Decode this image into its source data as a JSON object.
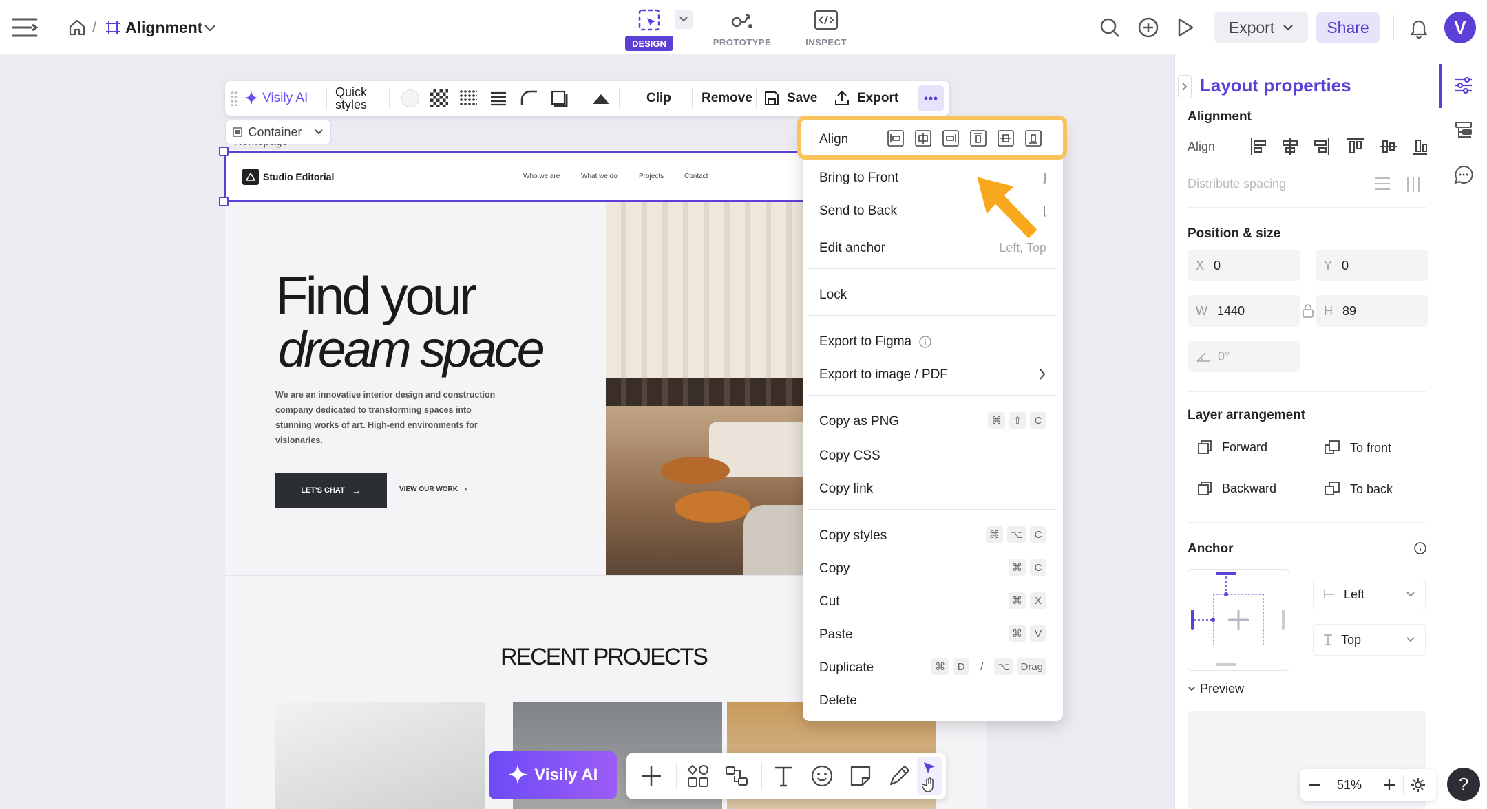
{
  "header": {
    "breadcrumb_sep": "/",
    "file_name": "Alignment",
    "modes": [
      {
        "label": "DESIGN",
        "active": true
      },
      {
        "label": "PROTOTYPE",
        "active": false
      },
      {
        "label": "INSPECT",
        "active": false
      }
    ],
    "export_label": "Export",
    "share_label": "Share",
    "avatar_letter": "V"
  },
  "toolbar": {
    "visily_ai": "Visily AI",
    "quick_styles_line1": "Quick",
    "quick_styles_line2": "styles",
    "clip": "Clip",
    "remove": "Remove",
    "save": "Save",
    "export": "Export"
  },
  "selection": {
    "container_label": "Container",
    "layer_label": "Homepage"
  },
  "page": {
    "nav_brand": "Studio Editorial",
    "nav_links": [
      "Who we are",
      "What we do",
      "Projects",
      "Contact"
    ],
    "hero_title_1": "Find your",
    "hero_title_2": "dream space",
    "hero_body": "We are an innovative interior design and construction company dedicated to transforming spaces into stunning works of art. High-end environments for visionaries.",
    "cta_primary": "LET'S CHAT",
    "cta_secondary": "VIEW OUR WORK",
    "section_title": "RECENT PROJECTS"
  },
  "context_menu": {
    "align_label": "Align",
    "bring_to_front": "Bring to Front",
    "bring_to_front_key": "]",
    "send_to_back": "Send to Back",
    "send_to_back_key": "[",
    "edit_anchor": "Edit anchor",
    "edit_anchor_value": "Left, Top",
    "lock": "Lock",
    "export_figma": "Export to Figma",
    "export_image": "Export to image / PDF",
    "copy_png": "Copy as PNG",
    "copy_css": "Copy CSS",
    "copy_link": "Copy link",
    "copy_styles": "Copy styles",
    "copy": "Copy",
    "cut": "Cut",
    "paste": "Paste",
    "duplicate": "Duplicate",
    "delete": "Delete",
    "keys": {
      "cmd": "⌘",
      "shift": "⇧",
      "opt": "⌥",
      "C": "C",
      "X": "X",
      "V": "V",
      "D": "D",
      "slash": "/",
      "drag": "Drag"
    }
  },
  "panel": {
    "title": "Layout properties",
    "alignment_title": "Alignment",
    "align_label": "Align",
    "distribute_label": "Distribute spacing",
    "position_title": "Position & size",
    "x_label": "X",
    "x_value": "0",
    "y_label": "Y",
    "y_value": "0",
    "w_label": "W",
    "w_value": "1440",
    "h_label": "H",
    "h_value": "89",
    "rotation_value": "0°",
    "layer_title": "Layer arrangement",
    "forward": "Forward",
    "to_front": "To front",
    "backward": "Backward",
    "to_back": "To back",
    "anchor_title": "Anchor",
    "anchor_h": "Left",
    "anchor_v": "Top",
    "preview": "Preview"
  },
  "bottom": {
    "visily_ai": "Visily AI",
    "zoom": "51%",
    "help": "?"
  },
  "colors": {
    "accent": "#5b3fd6",
    "highlight": "#f7c35a",
    "arrow": "#f8a81c"
  }
}
